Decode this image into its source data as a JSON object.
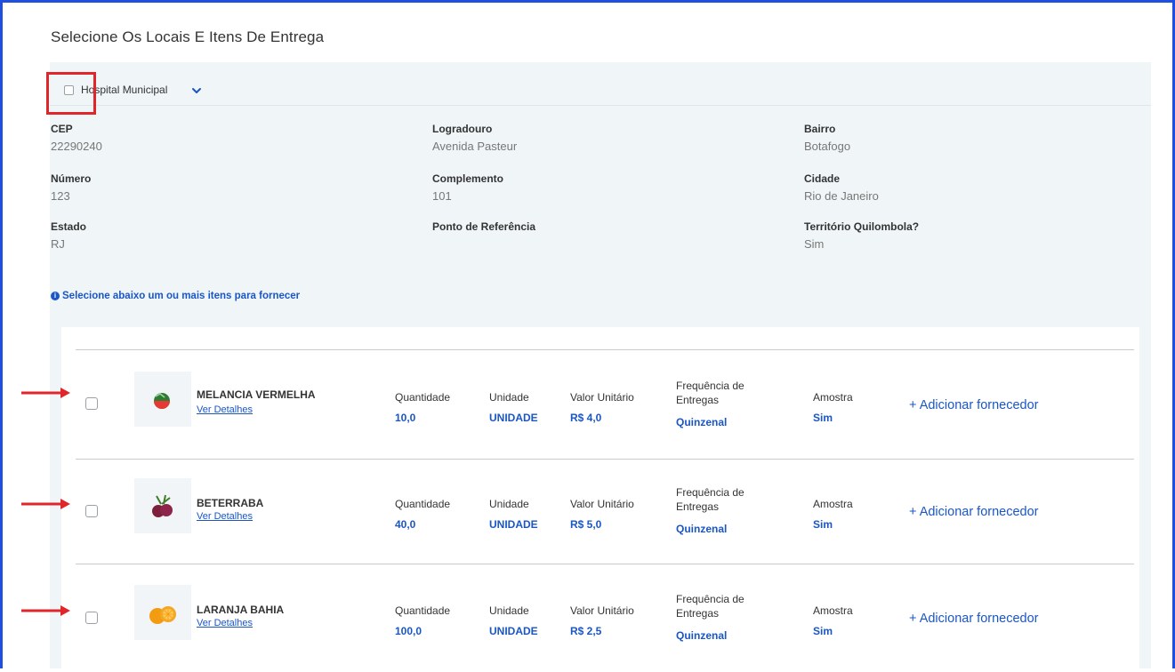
{
  "page": {
    "title": "Selecione Os Locais E Itens De Entrega"
  },
  "location": {
    "name": "Hospital Municipal",
    "fields": {
      "cep": {
        "label": "CEP",
        "value": "22290240"
      },
      "logradouro": {
        "label": "Logradouro",
        "value": "Avenida Pasteur"
      },
      "bairro": {
        "label": "Bairro",
        "value": "Botafogo"
      },
      "numero": {
        "label": "Número",
        "value": "123"
      },
      "complemento": {
        "label": "Complemento",
        "value": "101"
      },
      "cidade": {
        "label": "Cidade",
        "value": "Rio de Janeiro"
      },
      "estado": {
        "label": "Estado",
        "value": "RJ"
      },
      "ponto": {
        "label": "Ponto de Referência",
        "value": ""
      },
      "quilombola": {
        "label": "Território Quilombola?",
        "value": "Sim"
      }
    },
    "info_text": "Selecione abaixo um ou mais itens para fornecer"
  },
  "columns": {
    "quantidade": "Quantidade",
    "unidade": "Unidade",
    "valor": "Valor Unitário",
    "frequencia_1": "Frequência de",
    "frequencia_2": "Entregas",
    "amostra": "Amostra"
  },
  "details_label": "Ver Detalhes",
  "add_label": "+ Adicionar fornecedor",
  "items": [
    {
      "name": "MELANCIA VERMELHA",
      "quantidade": "10,0",
      "unidade": "UNIDADE",
      "valor": "R$ 4,0",
      "frequencia": "Quinzenal",
      "amostra": "Sim",
      "icon": "watermelon-icon"
    },
    {
      "name": "BETERRABA",
      "quantidade": "40,0",
      "unidade": "UNIDADE",
      "valor": "R$ 5,0",
      "frequencia": "Quinzenal",
      "amostra": "Sim",
      "icon": "beetroot-icon"
    },
    {
      "name": "LARANJA BAHIA",
      "quantidade": "100,0",
      "unidade": "UNIDADE",
      "valor": "R$ 2,5",
      "frequencia": "Quinzenal",
      "amostra": "Sim",
      "icon": "orange-icon"
    }
  ],
  "colors": {
    "accent": "#1a56c5",
    "highlight": "#e0262a",
    "panel": "#f0f5f8"
  }
}
